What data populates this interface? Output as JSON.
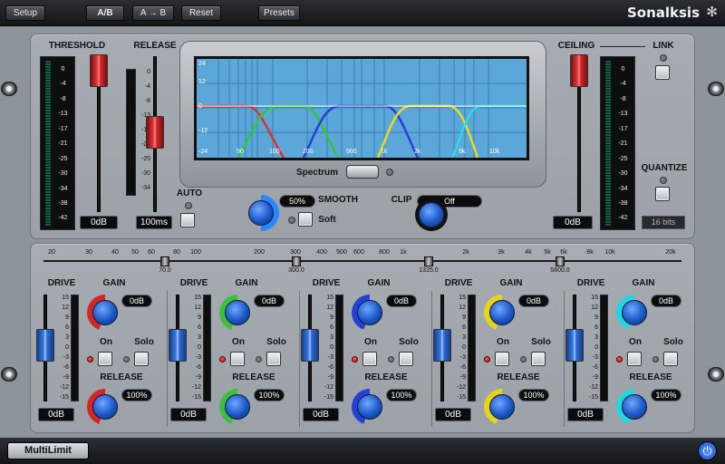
{
  "toolbar": {
    "setup": "Setup",
    "ab": "A/B",
    "a_to_b": "A → B",
    "reset": "Reset",
    "presets": "Presets",
    "brand": "Sonalksis"
  },
  "threshold": {
    "label": "THRESHOLD",
    "value": "0dB",
    "scale": [
      "0",
      "-4",
      "-8",
      "-13",
      "-17",
      "-21",
      "-25",
      "-30",
      "-34",
      "-38",
      "-42"
    ]
  },
  "release": {
    "label": "RELEASE",
    "value": "100ms",
    "fader_scale": [
      "0",
      "-4",
      "-8",
      "-13",
      "-17",
      "-21",
      "-25",
      "-30",
      "-34"
    ]
  },
  "auto": {
    "label": "AUTO"
  },
  "spectrum": {
    "label": "Spectrum",
    "db_labels": [
      "24",
      "12",
      "0",
      "-12",
      "-24"
    ],
    "freq_labels": [
      "50",
      "100",
      "200",
      "500",
      "1k",
      "2k",
      "5k",
      "10k"
    ]
  },
  "smooth": {
    "label": "SMOOTH",
    "value": "50%",
    "soft_label": "Soft"
  },
  "clip": {
    "label": "CLIP",
    "value": "Off"
  },
  "ceiling": {
    "label": "CEILING",
    "link_label": "LINK",
    "value": "0dB",
    "scale": [
      "0",
      "-4",
      "-8",
      "-13",
      "-17",
      "-21",
      "-25",
      "-30",
      "-34",
      "-38",
      "-42"
    ]
  },
  "quantize": {
    "label": "QUANTIZE",
    "value": "16 bits"
  },
  "crossover": {
    "scale": [
      "20",
      "30",
      "40",
      "50",
      "60",
      "80",
      "100",
      "200",
      "300",
      "400",
      "500",
      "600",
      "800",
      "1k",
      "2k",
      "3k",
      "4k",
      "5k",
      "6k",
      "8k",
      "10k",
      "20k"
    ],
    "points": [
      "70.0",
      "300.0",
      "1325.0",
      "5800.0"
    ]
  },
  "band_labels": {
    "drive": "DRIVE",
    "gain": "GAIN",
    "on": "On",
    "solo": "Solo",
    "release": "RELEASE",
    "scale": [
      "15",
      "12",
      "9",
      "6",
      "3",
      "0",
      "-3",
      "-6",
      "-9",
      "-12",
      "-15"
    ]
  },
  "bands": [
    {
      "color": "#d42525",
      "gain": "0dB",
      "release": "100%",
      "drive": "0dB"
    },
    {
      "color": "#3fbf3f",
      "gain": "0dB",
      "release": "100%",
      "drive": "0dB"
    },
    {
      "color": "#2541d4",
      "gain": "0dB",
      "release": "100%",
      "drive": "0dB"
    },
    {
      "color": "#e6d320",
      "gain": "0dB",
      "release": "100%",
      "drive": "0dB"
    },
    {
      "color": "#24d6e0",
      "gain": "0dB",
      "release": "100%",
      "drive": "0dB"
    }
  ],
  "footer": {
    "product": "MultiLimit"
  }
}
